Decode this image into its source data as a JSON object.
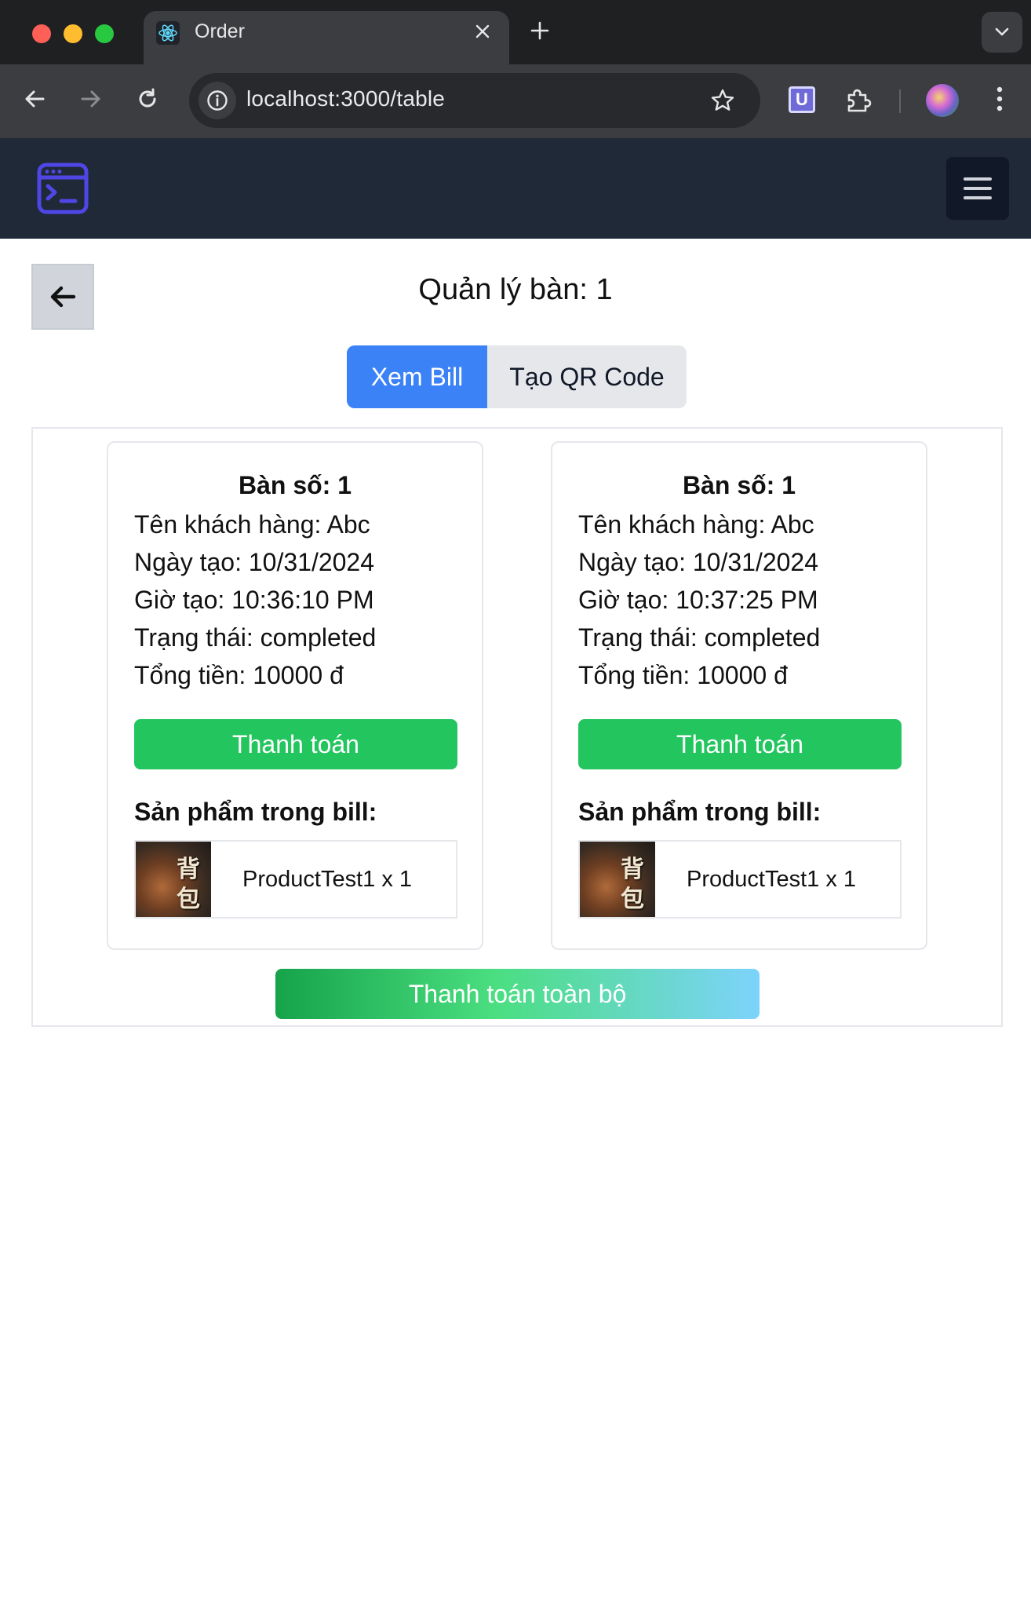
{
  "browser": {
    "tab_title": "Order",
    "url": "localhost:3000/table"
  },
  "app": {
    "logo_icon": "terminal-window-icon",
    "menu_icon": "hamburger-menu-icon",
    "accent_color": "#4f46e5"
  },
  "page": {
    "title": "Quản lý bàn: 1",
    "back_icon": "arrow-left-icon",
    "tabs": [
      {
        "label": "Xem Bill",
        "active": true
      },
      {
        "label": "Tạo QR Code",
        "active": false
      }
    ],
    "bills": [
      {
        "heading": "Bàn số: 1",
        "customer": "Tên khách hàng: Abc",
        "date": "Ngày tạo: 10/31/2024",
        "time": "Giờ tạo: 10:36:10 PM",
        "status": "Trạng thái: completed",
        "total": "Tổng tiền: 10000 đ",
        "pay_label": "Thanh toán",
        "products_title": "Sản phẩm trong bill:",
        "products": [
          {
            "name": "ProductTest1 x 1",
            "thumb_text": [
              "背",
              "包"
            ]
          }
        ]
      },
      {
        "heading": "Bàn số: 1",
        "customer": "Tên khách hàng: Abc",
        "date": "Ngày tạo: 10/31/2024",
        "time": "Giờ tạo: 10:37:25 PM",
        "status": "Trạng thái: completed",
        "total": "Tổng tiền: 10000 đ",
        "pay_label": "Thanh toán",
        "products_title": "Sản phẩm trong bill:",
        "products": [
          {
            "name": "ProductTest1 x 1",
            "thumb_text": [
              "背",
              "包"
            ]
          }
        ]
      }
    ],
    "pay_all_label": "Thanh toán toàn bộ",
    "colors": {
      "tab_active": "#3b82f6",
      "pay_button": "#22c55e",
      "navbar": "#1f2937"
    }
  }
}
